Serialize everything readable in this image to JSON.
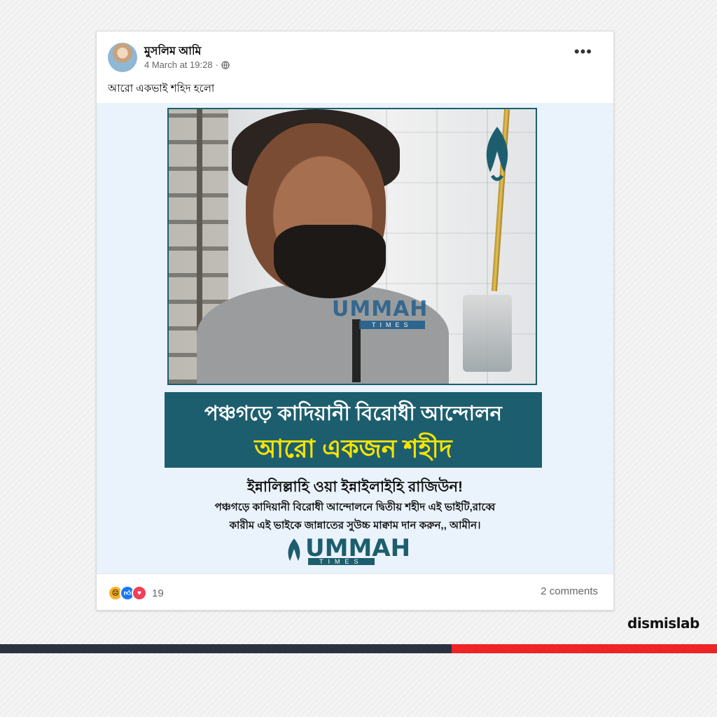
{
  "post": {
    "author": "মুসলিম আমি",
    "timestamp": "4 March at 19:28",
    "separator": "·",
    "privacy_icon": "globe-icon",
    "more_label": "•••",
    "caption": "আরো একভাই শহিদ হলো"
  },
  "image": {
    "watermark": "UMMAH",
    "watermark_sub": "TIMES",
    "banner_line1": "পঞ্চগড়ে কাদিয়ানী বিরোধী আন্দোলন",
    "banner_line2": "আরো একজন শহীদ",
    "text_line1": "ইন্নালিল্লাহি ওয়া ইন্নাইলাইহি রাজিউন!",
    "text_line2": "পঞ্চগড়ে কাদিয়ানী বিরোধী আন্দোলনে দ্বিতীয় শহীদ এই ভাইটি,রাব্বে",
    "text_line3": "কারীম এই ভাইকে জান্নাতের সুউচ্চ মাক্বাম দান করুন,, আমীন।",
    "brand_name": "UMMAH",
    "brand_sub": "TIMES",
    "colors": {
      "banner": "#1d5e6e",
      "banner_highlight": "#f7e400"
    }
  },
  "footer": {
    "reaction_icons": [
      "sad-react-icon",
      "like-react-icon",
      "love-react-icon"
    ],
    "reaction_count": "19",
    "comments": "2 comments"
  },
  "branding": {
    "logo_text": "dismislab",
    "colors": {
      "bar_dark": "#2c3340",
      "bar_red": "#ee2427"
    }
  }
}
